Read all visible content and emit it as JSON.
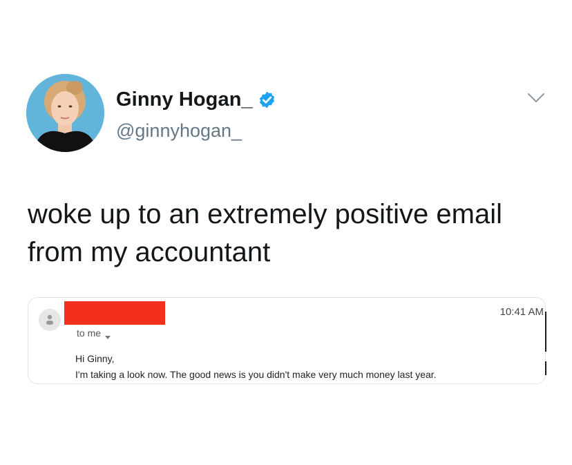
{
  "tweet": {
    "author": {
      "display_name": "Ginny Hogan_",
      "handle": "@ginnyhogan_",
      "verified": true,
      "avatar_icon": "profile-photo"
    },
    "menu_icon": "chevron-down-icon",
    "text": "woke up to an extremely positive email\nfrom my accountant",
    "embedded_email": {
      "sender_icon": "person-icon",
      "sender_redacted": true,
      "redaction_color": "#f2301b",
      "time": "10:41 AM",
      "recipient": "to me",
      "greeting": "Hi Ginny,",
      "body": "I'm taking a look now. The good news is you didn't make very much money last year."
    }
  },
  "colors": {
    "text": "#14171a",
    "secondary_text": "#657786",
    "verified_blue": "#1da1f2"
  }
}
